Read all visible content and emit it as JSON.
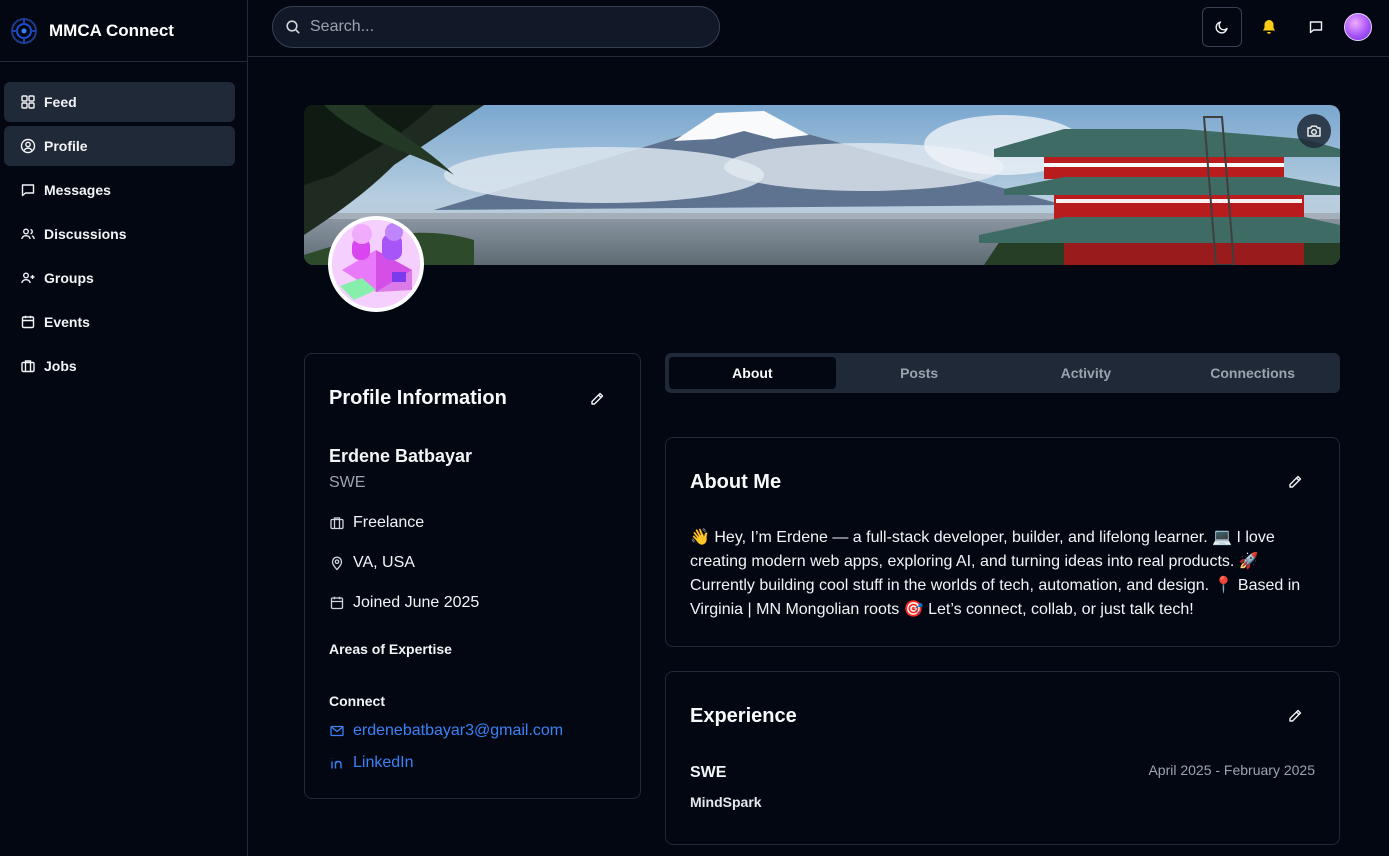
{
  "app": {
    "name": "MMCA Connect"
  },
  "sidebar": {
    "items": [
      {
        "label": "Feed",
        "icon": "grid-icon"
      },
      {
        "label": "Profile",
        "icon": "user-circle-icon"
      },
      {
        "label": "Messages",
        "icon": "message-icon"
      },
      {
        "label": "Discussions",
        "icon": "users-icon"
      },
      {
        "label": "Groups",
        "icon": "user-plus-icon"
      },
      {
        "label": "Events",
        "icon": "calendar-icon"
      },
      {
        "label": "Jobs",
        "icon": "briefcase-icon"
      }
    ]
  },
  "topbar": {
    "search_placeholder": "Search..."
  },
  "profile": {
    "card_title": "Profile Information",
    "name": "Erdene Batbayar",
    "role": "SWE",
    "employment": "Freelance",
    "location": "VA, USA",
    "joined": "Joined June 2025",
    "expertise_label": "Areas of Expertise",
    "connect_label": "Connect",
    "email": "erdenebatbayar3@gmail.com",
    "linkedin": "LinkedIn"
  },
  "tabs": [
    "About",
    "Posts",
    "Activity",
    "Connections"
  ],
  "about": {
    "title": "About Me",
    "text": "👋 Hey, I’m Erdene — a full-stack developer, builder, and lifelong learner. 💻 I love creating modern web apps, exploring AI, and turning ideas into real products. 🚀 Currently building cool stuff in the worlds of tech, automation, and design. 📍 Based in Virginia | MN Mongolian roots 🎯 Let’s connect, collab, or just talk tech!"
  },
  "experience": {
    "title": "Experience",
    "items": [
      {
        "role": "SWE",
        "company": "MindSpark",
        "dates": "April 2025 - February 2025"
      }
    ]
  },
  "colors": {
    "background": "#030712",
    "card_border": "#1f2937",
    "accent": "#3b82f6",
    "bell": "#facc15"
  }
}
